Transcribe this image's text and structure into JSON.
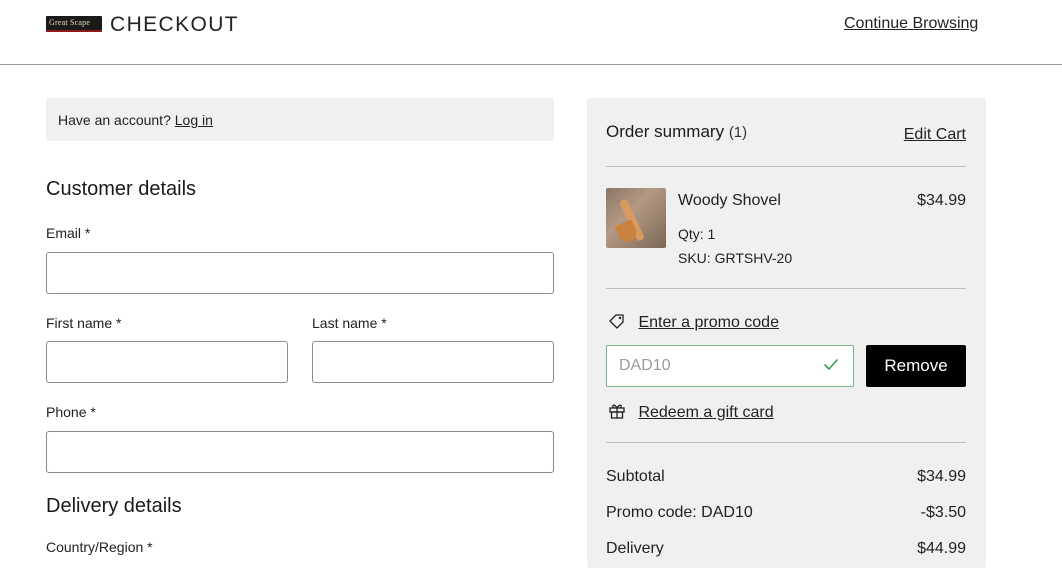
{
  "header": {
    "logo_text": "Great Scape",
    "title": "CHECKOUT",
    "continue_label": "Continue Browsing"
  },
  "account": {
    "prompt": "Have an account?",
    "login_label": "Log in"
  },
  "customer": {
    "title": "Customer details",
    "email_label": "Email *",
    "first_name_label": "First name *",
    "last_name_label": "Last name *",
    "phone_label": "Phone *"
  },
  "delivery": {
    "title": "Delivery details",
    "country_label": "Country/Region *"
  },
  "summary": {
    "title": "Order summary",
    "count": "(1)",
    "edit_cart_label": "Edit Cart",
    "item": {
      "name": "Woody Shovel",
      "price": "$34.99",
      "qty": "Qty: 1",
      "sku": "SKU: GRTSHV-20"
    },
    "promo_link": "Enter a promo code",
    "promo_value": "DAD10",
    "remove_label": "Remove",
    "gift_link": "Redeem a gift card",
    "totals": {
      "subtotal_label": "Subtotal",
      "subtotal_value": "$34.99",
      "promo_label": "Promo code: DAD10",
      "promo_value": "-$3.50",
      "delivery_label": "Delivery",
      "delivery_value": "$44.99"
    }
  },
  "icons": {
    "tag": "tag-icon",
    "gift": "gift-icon",
    "check": "check-icon"
  },
  "colors": {
    "panel_bg": "#f0f0f0",
    "valid_border": "#7fb38a",
    "button_bg": "#000000"
  }
}
